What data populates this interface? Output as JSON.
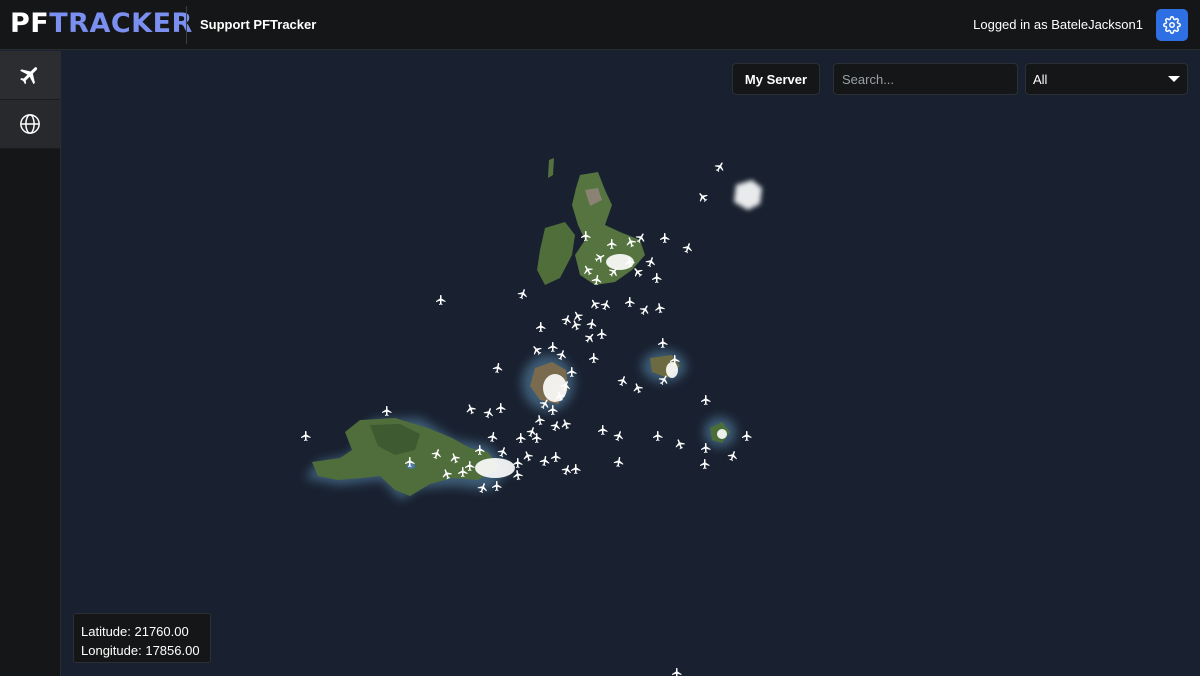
{
  "app": {
    "logo_part1": "PF",
    "logo_part2": "TRACKER",
    "support_link": "Support PFTracker",
    "logged_in": "Logged in as BateleJackson1",
    "accent_color": "#2f6fe4",
    "logo_color": "#7b8ff0"
  },
  "sidebar": {
    "items": [
      {
        "icon": "airplane-icon"
      },
      {
        "icon": "globe-icon"
      }
    ]
  },
  "toolbar": {
    "server_button": "My Server",
    "search_placeholder": "Search...",
    "filter_selected": "All"
  },
  "coords": {
    "latitude": "Latitude: 21760.00",
    "longitude": "Longitude: 17856.00"
  },
  "map": {
    "background_color": "#192130",
    "aircraft_icon": "airplane-icon"
  }
}
